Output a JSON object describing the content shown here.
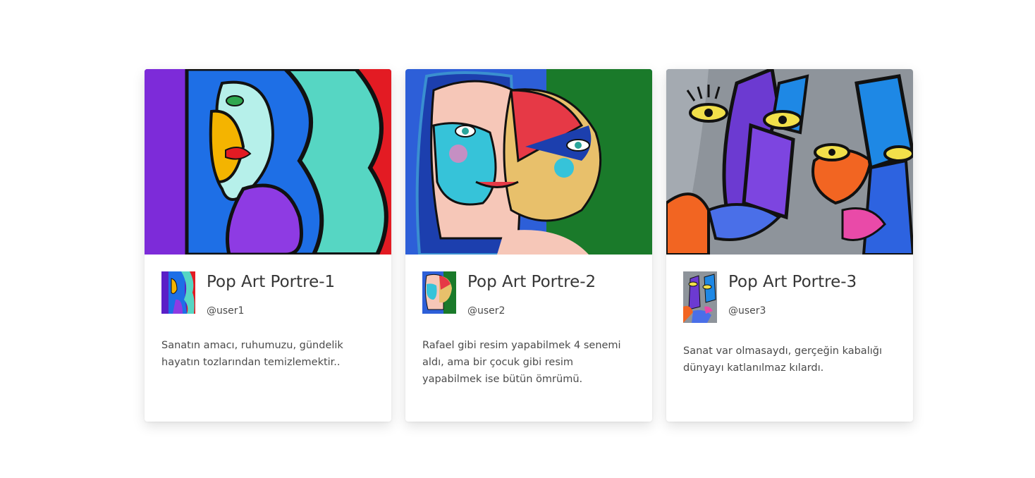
{
  "cards": [
    {
      "title": "Pop Art Portre-1",
      "user": "@user1",
      "text": "Sanatın amacı, ruhumuzu, gündelik hayatın tozlarından temizlemektir..",
      "palette": [
        "#6a1fd6",
        "#1e78e8",
        "#56d6c3",
        "#f4b400",
        "#e31b23"
      ]
    },
    {
      "title": "Pop Art Portre-2",
      "user": "@user2",
      "text": "Rafael gibi resim yapabilmek 4 senemi aldı, ama bir çocuk gibi resim yapabilmek ise bütün ömrümü.",
      "palette": [
        "#2d5fd8",
        "#f6c7b8",
        "#1a7a2a",
        "#e63946",
        "#36c3d9"
      ]
    },
    {
      "title": "Pop Art Portre-3",
      "user": "@user3",
      "text": "Sanat var olmasaydı, gerçeğin kabalığı dünyayı katlanılmaz kılardı.",
      "palette": [
        "#9aa0a6",
        "#6c3ad1",
        "#f26522",
        "#1e88e5",
        "#e94aa8"
      ]
    }
  ]
}
